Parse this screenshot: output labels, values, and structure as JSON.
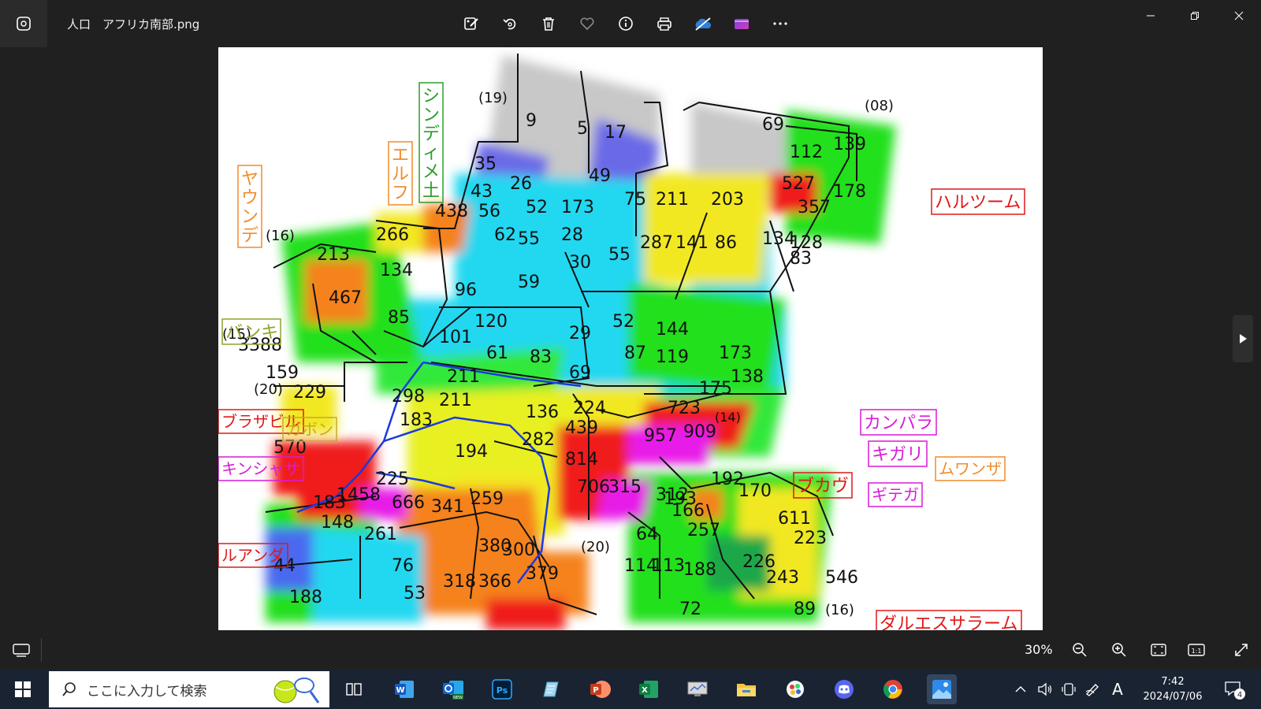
{
  "window": {
    "title": "人口　アフリカ南部.png",
    "zoom": "30%"
  },
  "toolbar": {
    "buttons": [
      "edit-image-icon",
      "rotate-icon",
      "delete-icon",
      "favorite-icon",
      "info-icon",
      "print-icon",
      "onedrive-icon",
      "video-editor-icon",
      "more-icon"
    ]
  },
  "map": {
    "labels": [
      {
        "text": "シンディメ土",
        "color": "#2a9d2a"
      },
      {
        "text": "エルフ",
        "color": "#f08c2a"
      },
      {
        "text": "ヤウンデ",
        "color": "#f08c2a"
      },
      {
        "text": "バンキ",
        "color": "#8aa62a"
      },
      {
        "text": "ブラザビル",
        "color": "#e01818"
      },
      {
        "text": "ガボン",
        "color": "#c8a82a"
      },
      {
        "text": "キンシャサ",
        "color": "#d91ad9"
      },
      {
        "text": "ルアンダ",
        "color": "#e01818"
      },
      {
        "text": "ハルツーム",
        "color": "#e01818"
      },
      {
        "text": "カンパラ",
        "color": "#d91ad9"
      },
      {
        "text": "キガリ",
        "color": "#d91ad9"
      },
      {
        "text": "ムワンザ",
        "color": "#f08c2a"
      },
      {
        "text": "ブカヴ",
        "color": "#e01818"
      },
      {
        "text": "ギテガ",
        "color": "#d91ad9"
      },
      {
        "text": "ダルエスサラーム",
        "color": "#e01818"
      }
    ],
    "numbers": [
      "(19)",
      "(08)",
      "(16)",
      "(15)",
      "(20)",
      "(14)",
      "(20)",
      "(16)",
      "9",
      "5",
      "17",
      "69",
      "112",
      "139",
      "35",
      "26",
      "49",
      "527",
      "178",
      "43",
      "52",
      "173",
      "75",
      "211",
      "203",
      "357",
      "438",
      "56",
      "62",
      "28",
      "287",
      "141",
      "86",
      "134",
      "128",
      "266",
      "213",
      "134",
      "55",
      "30",
      "55",
      "83",
      "467",
      "85",
      "59",
      "101",
      "120",
      "96",
      "52",
      "144",
      "119",
      "173",
      "87",
      "3388",
      "159",
      "211",
      "61",
      "83",
      "29",
      "69",
      "175",
      "138",
      "229",
      "298",
      "211",
      "136",
      "224",
      "723",
      "439",
      "282",
      "183",
      "194",
      "957",
      "909",
      "570",
      "814",
      "225",
      "1458",
      "666",
      "341",
      "259",
      "706",
      "315",
      "183",
      "261",
      "148",
      "76",
      "53",
      "188",
      "44",
      "380",
      "300",
      "379",
      "318",
      "366",
      "192",
      "170",
      "166",
      "257",
      "64",
      "611",
      "223",
      "114",
      "113",
      "188",
      "226",
      "243",
      "72",
      "89",
      "546",
      "312",
      "193"
    ]
  },
  "taskbar": {
    "search_placeholder": "ここに入力して検索",
    "time": "7:42",
    "date": "2024/07/06",
    "notifications": "4",
    "ime": "A",
    "apps": [
      "task-view-icon",
      "word-icon",
      "outlook-icon",
      "photoshop-icon",
      "notepad-icon",
      "powerpoint-icon",
      "excel-icon",
      "monitor-icon",
      "file-explorer-icon",
      "paint-icon",
      "discord-icon",
      "chrome-icon",
      "photos-icon"
    ]
  },
  "colors": {
    "titlebar": "#202020",
    "taskbar": "#1a2332",
    "accent": "#4aa8ff"
  }
}
